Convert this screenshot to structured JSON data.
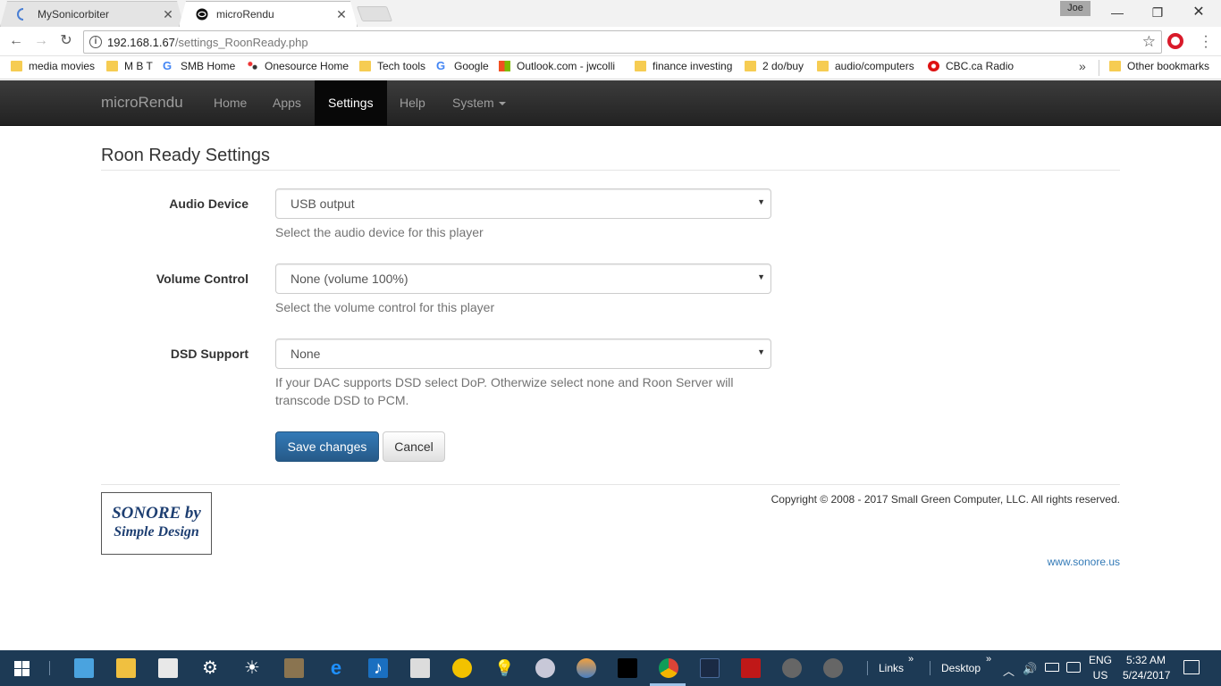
{
  "browser": {
    "tabs": [
      {
        "title": "MySonicorbiter",
        "active": false
      },
      {
        "title": "microRendu",
        "active": true
      }
    ],
    "user": "Joe",
    "url_host": "192.168.1.67",
    "url_path": "/settings_RoonReady.php",
    "bookmarks": [
      {
        "label": "media movies",
        "icon": "folder-icon"
      },
      {
        "label": "M B T",
        "icon": "folder-icon"
      },
      {
        "label": "SMB Home",
        "icon": "google-icon"
      },
      {
        "label": "Onesource Home",
        "icon": "dots-icon"
      },
      {
        "label": "Tech tools",
        "icon": "folder-icon"
      },
      {
        "label": "Google",
        "icon": "google-icon"
      },
      {
        "label": "Outlook.com - jwcolli",
        "icon": "windows-icon"
      },
      {
        "label": "finance investing",
        "icon": "folder-icon"
      },
      {
        "label": "2 do/buy",
        "icon": "folder-icon"
      },
      {
        "label": "audio/computers",
        "icon": "folder-icon"
      },
      {
        "label": "CBC.ca Radio",
        "icon": "cbc-icon"
      }
    ],
    "other_bookmarks": "Other bookmarks",
    "more": "»"
  },
  "navbar": {
    "brand": "microRendu",
    "items": [
      "Home",
      "Apps",
      "Settings",
      "Help",
      "System"
    ],
    "active": "Settings"
  },
  "page": {
    "title": "Roon Ready Settings",
    "fields": [
      {
        "label": "Audio Device",
        "value": "USB output",
        "help": "Select the audio device for this player"
      },
      {
        "label": "Volume Control",
        "value": "None (volume 100%)",
        "help": "Select the volume control for this player"
      },
      {
        "label": "DSD Support",
        "value": "None",
        "help": "If your DAC supports DSD select DoP. Otherwize select none and Roon Server will transcode DSD to PCM."
      }
    ],
    "save_label": "Save changes",
    "cancel_label": "Cancel"
  },
  "footer": {
    "logo_line1": "SONORE by",
    "logo_line2": "Simple Design",
    "copyright": "Copyright © 2008 - 2017 Small Green Computer, LLC. All rights reserved.",
    "link": "www.sonore.us"
  },
  "taskbar": {
    "links": "Links",
    "desktop": "Desktop",
    "lang1": "ENG",
    "lang2": "US",
    "time": "5:32 AM",
    "date": "5/24/2017",
    "chevrons": "»"
  }
}
